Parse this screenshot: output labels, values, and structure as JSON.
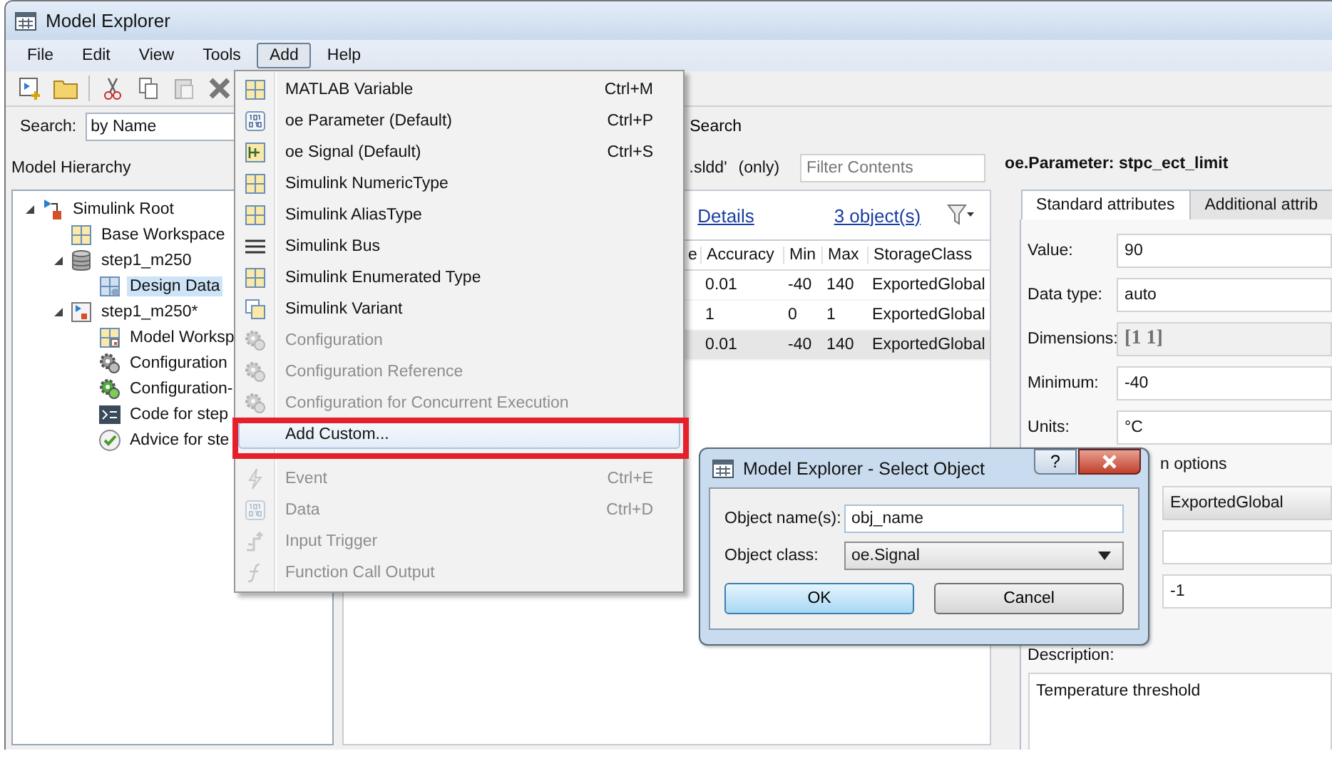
{
  "window": {
    "title": "Model Explorer"
  },
  "menubar": [
    {
      "label": "File",
      "selected": false
    },
    {
      "label": "Edit",
      "selected": false
    },
    {
      "label": "View",
      "selected": false
    },
    {
      "label": "Tools",
      "selected": false
    },
    {
      "label": "Add",
      "selected": true
    },
    {
      "label": "Help",
      "selected": false
    }
  ],
  "search": {
    "label": "Search:",
    "mode": "by Name",
    "button": "Search"
  },
  "hierarchy": {
    "title": "Model Hierarchy",
    "items": [
      {
        "label": "Simulink Root",
        "expanded": true,
        "selected": false,
        "children": [
          {
            "label": "Base Workspace",
            "selected": false
          },
          {
            "label": "step1_m250",
            "expanded": true,
            "selected": false,
            "children": [
              {
                "label": "Design Data",
                "selected": true
              }
            ]
          },
          {
            "label": "step1_m250*",
            "expanded": true,
            "selected": false,
            "children": [
              {
                "label": "Model Worksp",
                "selected": false
              },
              {
                "label": "Configuration",
                "selected": false
              },
              {
                "label": "Configuration-",
                "selected": false
              },
              {
                "label": "Code for step",
                "selected": false
              },
              {
                "label": "Advice for ste",
                "selected": false
              }
            ]
          }
        ]
      }
    ]
  },
  "contents": {
    "scope": ".sldd'",
    "scope_note": "(only)",
    "filter": {
      "placeholder": "Filter Contents"
    },
    "details_link": "Details",
    "count_link": "3 object(s)",
    "table": {
      "cut_column": "e",
      "columns": [
        "Accuracy",
        "Min",
        "Max",
        "StorageClass"
      ],
      "rows": [
        {
          "cells": [
            "0.01",
            "-40",
            "140",
            "ExportedGlobal"
          ],
          "selected": false
        },
        {
          "cells": [
            "1",
            "0",
            "1",
            "ExportedGlobal"
          ],
          "selected": false
        },
        {
          "cells": [
            "0.01",
            "-40",
            "140",
            "ExportedGlobal"
          ],
          "selected": true
        }
      ]
    }
  },
  "properties": {
    "title": "oe.Parameter: stpc_ect_limit",
    "tabs": [
      {
        "label": "Standard attributes",
        "selected": true
      },
      {
        "label": "Additional attrib",
        "selected": false
      }
    ],
    "fields": [
      {
        "label": "Value:",
        "value": "90",
        "disabled": false
      },
      {
        "label": "Data type:",
        "value": "auto",
        "disabled": false
      },
      {
        "label": "Dimensions:",
        "value": "[1 1]",
        "disabled": true
      },
      {
        "label": "Minimum:",
        "value": "-40",
        "disabled": false
      },
      {
        "label": "Units:",
        "value": "°C",
        "disabled": false
      }
    ],
    "group_label": "n options",
    "group_fields": [
      {
        "kind": "dropdown",
        "value": "ExportedGlobal"
      },
      {
        "kind": "text"
      },
      {
        "kind": "text",
        "value": "-1"
      }
    ],
    "description": {
      "label": "Description:",
      "value": "Temperature threshold"
    }
  },
  "add_menu": {
    "sections": [
      {
        "items": [
          {
            "label": "MATLAB Variable",
            "shortcut": "Ctrl+M",
            "disabled": false,
            "selected": false,
            "callout": false
          },
          {
            "label": "oe Parameter (Default)",
            "shortcut": "Ctrl+P",
            "disabled": false,
            "selected": false,
            "callout": false
          },
          {
            "label": "oe Signal (Default)",
            "shortcut": "Ctrl+S",
            "disabled": false,
            "selected": false,
            "callout": false
          },
          {
            "label": "Simulink NumericType",
            "disabled": false,
            "selected": false,
            "callout": false
          },
          {
            "label": "Simulink AliasType",
            "disabled": false,
            "selected": false,
            "callout": false
          },
          {
            "label": "Simulink Bus",
            "disabled": false,
            "selected": false,
            "callout": false
          },
          {
            "label": "Simulink Enumerated Type",
            "disabled": false,
            "selected": false,
            "callout": false
          },
          {
            "label": "Simulink Variant",
            "disabled": false,
            "selected": false,
            "callout": false
          },
          {
            "label": "Configuration",
            "disabled": true,
            "selected": false,
            "callout": false
          },
          {
            "label": "Configuration Reference",
            "disabled": true,
            "selected": false,
            "callout": false
          },
          {
            "label": "Configuration for Concurrent Execution",
            "disabled": true,
            "selected": false,
            "callout": false
          },
          {
            "label": "Add Custom...",
            "disabled": false,
            "selected": true,
            "callout": true
          }
        ]
      },
      {
        "items": [
          {
            "label": "Event",
            "shortcut": "Ctrl+E",
            "disabled": true,
            "selected": false,
            "callout": false
          },
          {
            "label": "Data",
            "shortcut": "Ctrl+D",
            "disabled": true,
            "selected": false,
            "callout": false
          },
          {
            "label": "Input Trigger",
            "disabled": true,
            "selected": false,
            "callout": false
          },
          {
            "label": "Function Call Output",
            "disabled": true,
            "selected": false,
            "callout": false
          }
        ]
      }
    ]
  },
  "dialog": {
    "title": "Model Explorer - Select Object",
    "help": "?",
    "fields": [
      {
        "label": "Object name(s):",
        "kind": "text",
        "value": "obj_name"
      },
      {
        "label": "Object class:",
        "kind": "dropdown",
        "value": "oe.Signal"
      }
    ],
    "buttons": [
      {
        "label": "OK",
        "default": true
      },
      {
        "label": "Cancel",
        "default": false
      }
    ]
  }
}
